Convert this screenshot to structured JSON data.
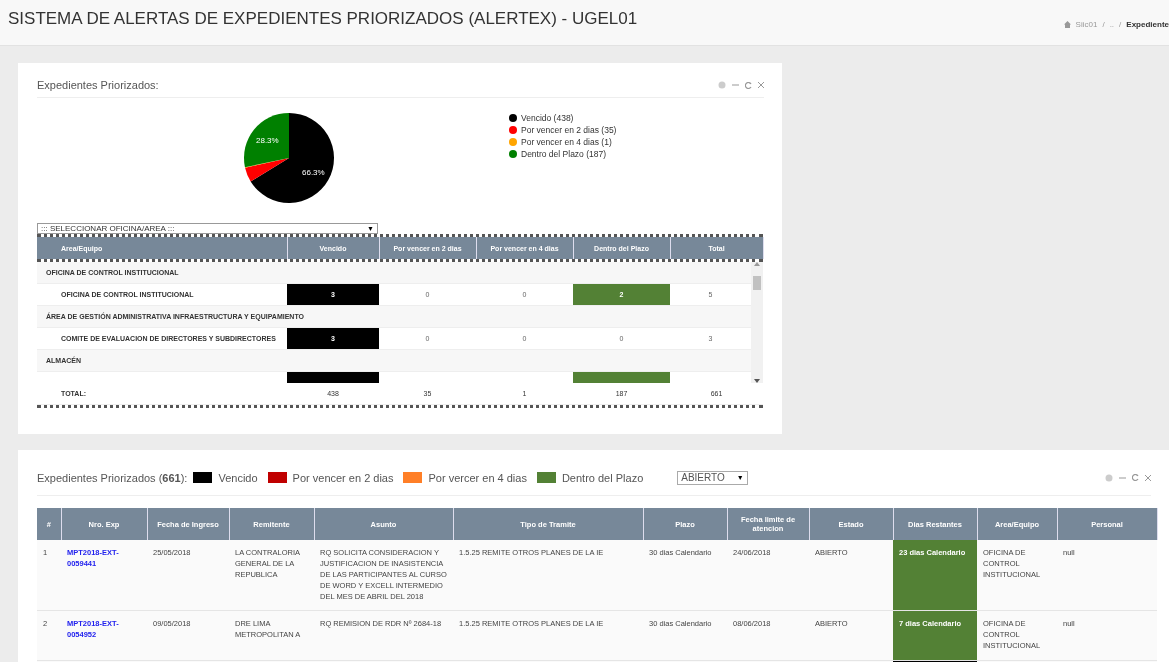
{
  "page_header": {
    "title": "SISTEMA DE ALERTAS DE EXPEDIENTES PRIORIZADOS (ALERTEX) - UGEL01",
    "breadcrumb": [
      "Siic01",
      "..",
      "Expediente"
    ],
    "separator": "/"
  },
  "summary_panel": {
    "title": "Expedientes Priorizados:",
    "chart_data": {
      "type": "pie",
      "categories": [
        "Vencido (438)",
        "Por vencer en 2 dias (35)",
        "Por vencer en 4 dias (1)",
        "Dentro del Plazo (187)"
      ],
      "values": [
        66.3,
        5.3,
        0.2,
        28.3
      ],
      "colors": [
        "#000000",
        "#ff0000",
        "#ffa500",
        "#008000"
      ],
      "value_labels": [
        "66.3%",
        null,
        null,
        "28.3%"
      ]
    },
    "office_select": {
      "value": "::: SELECCIONAR OFICINA/AREA :::",
      "arrow": "▼"
    },
    "table": {
      "columns": [
        "Area/Equipo",
        "Vencido",
        "Por vencer en 2 dias",
        "Por vencer en 4 dias",
        "Dentro del Plazo",
        "Total"
      ],
      "rows": [
        {
          "kind": "group",
          "label": "OFICINA DE CONTROL INSTITUCIONAL"
        },
        {
          "kind": "item",
          "label": "OFICINA DE CONTROL INSTITUCIONAL",
          "values": [
            "3",
            "0",
            "0",
            "2",
            "5"
          ],
          "alerts": [
            true,
            false,
            false,
            true,
            false
          ]
        },
        {
          "kind": "group",
          "label": "ÁREA DE GESTIÓN ADMINISTRATIVA INFRAESTRUCTURA Y EQUIPAMIENTO"
        },
        {
          "kind": "item",
          "label": "COMITE DE EVALUACION DE DIRECTORES Y SUBDIRECTORES",
          "values": [
            "3",
            "0",
            "0",
            "0",
            "3"
          ],
          "alerts": [
            true,
            false,
            false,
            false,
            false
          ]
        },
        {
          "kind": "group",
          "label": "ALMACÉN"
        },
        {
          "kind": "item",
          "alerts": [
            true,
            false,
            false,
            true,
            false
          ]
        }
      ],
      "total": {
        "label": "TOTAL:",
        "values": [
          "438",
          "35",
          "1",
          "187",
          "661"
        ]
      }
    }
  },
  "detail_panel": {
    "title": "Expedientes Priorizados (",
    "count": "661",
    "title_end": "):",
    "legend": [
      {
        "label": "Vencido",
        "color": "#000000"
      },
      {
        "label": "Por vencer en 2 dias",
        "color": "#c00000"
      },
      {
        "label": "Por vercer en 4 dias",
        "color": "#ff7f27"
      },
      {
        "label": "Dentro del Plazo",
        "color": "#538135"
      }
    ],
    "state_select": {
      "value": "ABIERTO",
      "arrow": "▼"
    },
    "table": {
      "columns": [
        "#",
        "Nro. Exp",
        "Fecha de Ingreso",
        "Remitente",
        "Asunto",
        "Tipo de Tramite",
        "Plazo",
        "Fecha limite de atencion",
        "Estado",
        "Dias Restantes",
        "Area/Equipo",
        "Personal"
      ],
      "rows": [
        {
          "number": "1",
          "expediente": "MPT2018-EXT-0059441",
          "fecha_ingreso": "25/05/2018",
          "remitente": "LA CONTRALORIA GENERAL DE LA REPUBLICA",
          "asunto": "RQ SOLICITA CONSIDERACION Y JUSTIFICACION DE INASISTENCIA DE LAS PARTICIPANTES AL CURSO DE WORD Y EXCELL INTERMEDIO DEL MES DE ABRIL DEL 2018",
          "tipo_tramite": "1.5.25 REMITE OTROS PLANES DE LA IE",
          "plazo": "30 dias Calendario",
          "fecha_limite": "24/06/2018",
          "estado": "ABIERTO",
          "dias_restantes": "23 dias Calendario",
          "color": "#538135",
          "area": "OFICINA DE CONTROL INSTITUCIONAL",
          "personal": "null"
        },
        {
          "number": "2",
          "expediente": "MPT2018-EXT-0054952",
          "fecha_ingreso": "09/05/2018",
          "remitente": "DRE LIMA METROPOLITAN A",
          "asunto": "RQ REMISION DE RDR Nº 2684-18",
          "tipo_tramite": "1.5.25 REMITE OTROS PLANES DE LA IE",
          "plazo": "30 dias Calendario",
          "fecha_limite": "08/06/2018",
          "estado": "ABIERTO",
          "dias_restantes": "7 dias Calendario",
          "color": "#538135",
          "area": "OFICINA DE CONTROL INSTITUCIONAL",
          "personal": "null"
        },
        {
          "color": "#000000"
        }
      ]
    }
  }
}
